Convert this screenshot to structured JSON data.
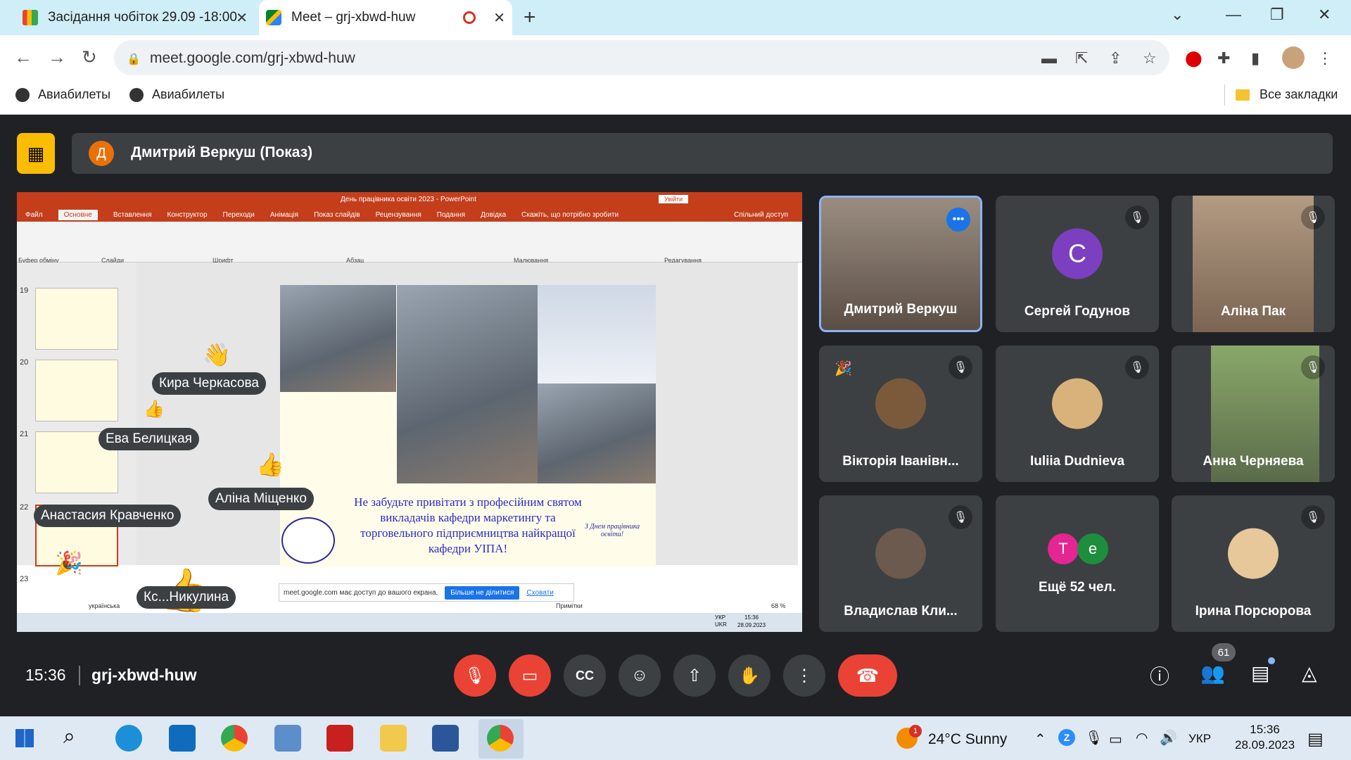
{
  "browser": {
    "tabs": [
      {
        "title": "Засідання чобіток 29.09 -18:00"
      },
      {
        "title": "Meet – grj-xbwd-huw"
      }
    ],
    "url": "meet.google.com/grj-xbwd-huw",
    "bookmarks": [
      "Авиабилеты",
      "Авиабилеты"
    ],
    "all_bookmarks": "Все закладки"
  },
  "presenter": {
    "initial": "Д",
    "label": "Дмитрий Веркуш (Показ)"
  },
  "shared_screen": {
    "ppt_title": "День працівника освіти 2023  -  PowerPoint",
    "login": "Увійти",
    "ribbon_tabs": [
      "Файл",
      "Основне",
      "Вставлення",
      "Конструктор",
      "Переходи",
      "Анімація",
      "Показ слайдів",
      "Рецензування",
      "Подання",
      "Довідка",
      "Скажіть, що потрібно зробити"
    ],
    "share_access": "Спільний доступ",
    "ribbon_groups": [
      "Буфер обміну",
      "Слайди",
      "Шрифт",
      "Абзац",
      "Малювання",
      "Редагування"
    ],
    "slide_numbers": [
      "19",
      "20",
      "21",
      "22",
      "23"
    ],
    "slide_text": "Не забудьте привітати з професійним святом викладачів кафедри маркетингу та торговельного підприємництва найкращої кафедри УІПА!",
    "slide_corner": "З Днем працівника освіти!",
    "share_notice": "meet.google.com має доступ до вашого екрана.",
    "stop_share": "Більше не ділитися",
    "hide": "Сховати",
    "notes": "Примітки",
    "zoom": "68 %",
    "lang": "українська",
    "inner_clock": {
      "lang": "УКР\nUKR",
      "time": "15:36",
      "date": "28.09.2023"
    }
  },
  "reactions": [
    {
      "name": "Кира Черкасова",
      "emoji": "👋"
    },
    {
      "name": "Ева Белицкая",
      "emoji": "👍"
    },
    {
      "name": "Аліна Міщенко",
      "emoji": "👍"
    },
    {
      "name": "Анастасия Кравченко",
      "emoji": "🎉"
    },
    {
      "name": "Кс...Никулина",
      "emoji": "👍"
    }
  ],
  "participants": [
    {
      "name": "Дмитрий Веркуш",
      "type": "video",
      "state": "speaking"
    },
    {
      "name": "Сергей Годунов",
      "type": "letter",
      "letter": "C",
      "state": "muted"
    },
    {
      "name": "Аліна Пак",
      "type": "video",
      "state": "muted"
    },
    {
      "name": "Вікторія Іванівн...",
      "type": "photo",
      "state": "muted"
    },
    {
      "name": "Iuliia Dudnieva",
      "type": "photo",
      "state": "muted"
    },
    {
      "name": "Анна Черняева",
      "type": "video",
      "state": "muted"
    },
    {
      "name": "Владислав Кли...",
      "type": "photo",
      "state": "muted"
    },
    {
      "name": "Ещё 52 чел.",
      "type": "more",
      "letters": [
        "T",
        "e"
      ]
    },
    {
      "name": "Ірина Порсюрова",
      "type": "photo",
      "state": "muted"
    }
  ],
  "controls": {
    "time": "15:36",
    "meeting_code": "grj-xbwd-huw",
    "participant_count": "61"
  },
  "taskbar": {
    "weather": "24°C  Sunny",
    "weather_badge": "1",
    "lang": "УКР",
    "time": "15:36",
    "date": "28.09.2023"
  },
  "colors": {
    "accent_blue": "#8ab4f8",
    "leave_red": "#ea4335",
    "presenter_yellow": "#fbbc04",
    "ppt_red": "#c43e1c"
  }
}
